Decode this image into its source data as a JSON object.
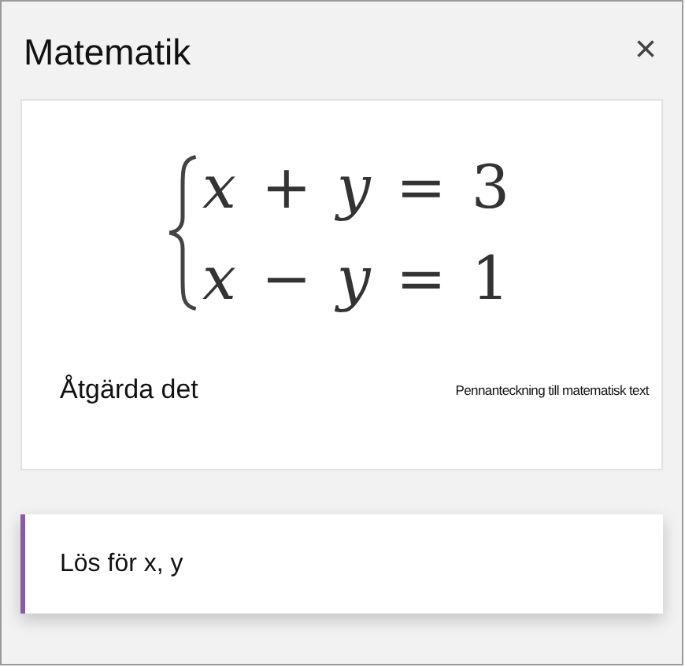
{
  "panel": {
    "title": "Matematik",
    "close": "×"
  },
  "card": {
    "equations": [
      "*x* + *y* = 3",
      "*x* − *y* = 1"
    ],
    "fix_link": "Åtgärda det",
    "caption": "Pennanteckning till matematisk text"
  },
  "actions": [
    {
      "label": "Lös för x, y",
      "selected": true
    }
  ]
}
